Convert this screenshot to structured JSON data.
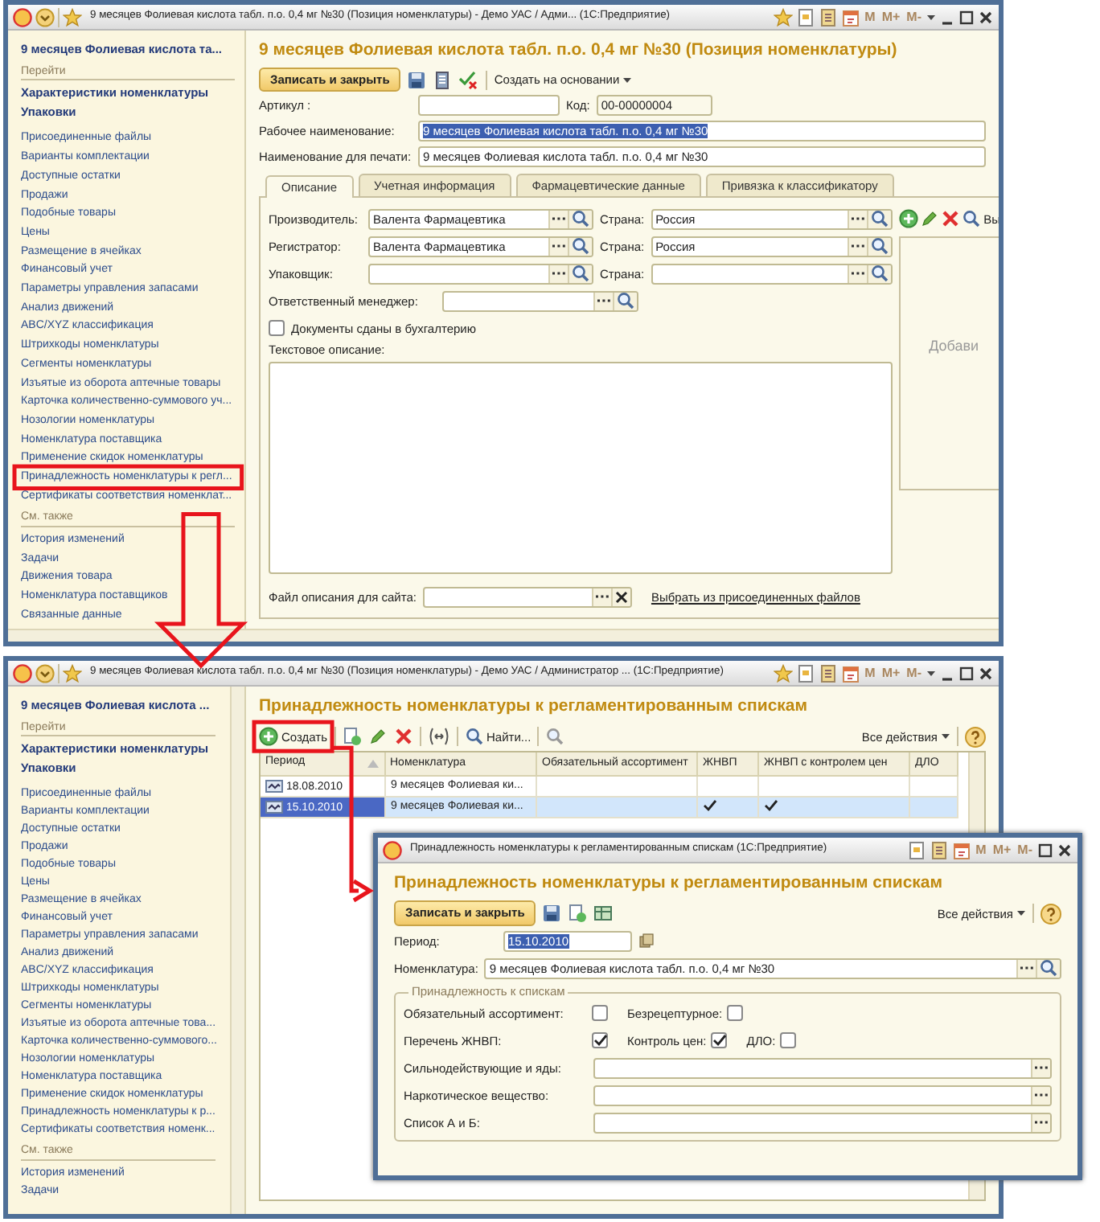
{
  "main_window": {
    "title": "9 месяцев Фолиевая кислота табл. п.о. 0,4 мг №30 (Позиция номенклатуры) - Демо УАС / Адми... (1С:Предприятие)",
    "memory_buttons": [
      "M",
      "M+",
      "M-"
    ],
    "sidebar": {
      "header": "9 месяцев Фолиевая кислота та...",
      "goto_label": "Перейти",
      "goto_items": [
        "Характеристики номенклатуры",
        "Упаковки"
      ],
      "items": [
        {
          "label": "Присоединенные файлы",
          "highlighted": false
        },
        {
          "label": "Варианты комплектации",
          "highlighted": false
        },
        {
          "label": "Доступные остатки",
          "highlighted": false
        },
        {
          "label": "Продажи",
          "highlighted": false
        },
        {
          "label": "Подобные товары",
          "highlighted": false
        },
        {
          "label": "Цены",
          "highlighted": false
        },
        {
          "label": "Размещение в ячейках",
          "highlighted": false
        },
        {
          "label": "Финансовый учет",
          "highlighted": false
        },
        {
          "label": "Параметры управления запасами",
          "highlighted": false
        },
        {
          "label": "Анализ движений",
          "highlighted": false
        },
        {
          "label": "ABC/XYZ классификация",
          "highlighted": false
        },
        {
          "label": "Штрихкоды номенклатуры",
          "highlighted": false
        },
        {
          "label": "Сегменты номенклатуры",
          "highlighted": false
        },
        {
          "label": "Изъятые из оборота аптечные товары",
          "highlighted": false
        },
        {
          "label": "Карточка количественно-суммового уч...",
          "highlighted": false
        },
        {
          "label": "Нозологии номенклатуры",
          "highlighted": false
        },
        {
          "label": "Номенклатура поставщика",
          "highlighted": false
        },
        {
          "label": "Применение скидок номенклатуры",
          "highlighted": false
        },
        {
          "label": "Принадлежность номенклатуры к регл...",
          "highlighted": true
        },
        {
          "label": "Сертификаты соответствия номенклат...",
          "highlighted": false
        }
      ],
      "see_also_label": "См. также",
      "see_also_items": [
        "История изменений",
        "Задачи",
        "Движения товара",
        "Номенклатура поставщиков",
        "Связанные данные"
      ]
    },
    "form": {
      "heading": "9 месяцев Фолиевая кислота табл. п.о. 0,4 мг №30 (Позиция номенклатуры)",
      "save_button": "Записать и закрыть",
      "create_based": "Создать на основании",
      "article_label": "Артикул :",
      "code_label": "Код:",
      "code_value": "00-00000004",
      "working_name": {
        "label": "Рабочее наименование:",
        "value": "9 месяцев Фолиевая кислота табл. п.о. 0,4 мг №30",
        "text_selected": true
      },
      "print_name": {
        "label": "Наименование для печати:",
        "value": "9 месяцев Фолиевая кислота табл. п.о. 0,4 мг №30",
        "text_selected": false
      },
      "tabs": [
        {
          "label": "Описание",
          "selected": true
        },
        {
          "label": "Учетная информация",
          "selected": false
        },
        {
          "label": "Фармацевтические данные",
          "selected": false
        },
        {
          "label": "Привязка к классификатору",
          "selected": false
        }
      ],
      "parties": [
        {
          "label": "Производитель:",
          "value": "Валента Фармацевтика",
          "country_label": "Страна:",
          "country": "Россия"
        },
        {
          "label": "Регистратор:",
          "value": "Валента Фармацевтика",
          "country_label": "Страна:",
          "country": "Россия"
        },
        {
          "label": "Упаковщик:",
          "country_label": "Страна:"
        }
      ],
      "manager_label": "Ответственный менеджер:",
      "docs_checkbox": {
        "label": "Документы сданы в бухгалтерию",
        "checked": false
      },
      "description_label": "Текстовое описание:",
      "file_label": "Файл описания для сайта:",
      "file_link": "Выбрать из присоединенных файлов",
      "side_panel": {
        "toolbar_text": "Вы",
        "placeholder": "Добави"
      }
    }
  },
  "list_window": {
    "title": "9 месяцев Фолиевая кислота табл. п.о. 0,4 мг №30 (Позиция номенклатуры) - Демо УАС / Администратор ... (1С:Предприятие)",
    "memory_buttons": [
      "M",
      "M+",
      "M-"
    ],
    "sidebar": {
      "header": "9 месяцев Фолиевая кислота ...",
      "goto_label": "Перейти",
      "goto_items": [
        "Характеристики номенклатуры",
        "Упаковки"
      ],
      "items": [
        {
          "label": "Присоединенные файлы",
          "highlighted": false
        },
        {
          "label": "Варианты комплектации",
          "highlighted": false
        },
        {
          "label": "Доступные остатки",
          "highlighted": false
        },
        {
          "label": "Продажи",
          "highlighted": false
        },
        {
          "label": "Подобные товары",
          "highlighted": false
        },
        {
          "label": "Цены",
          "highlighted": false
        },
        {
          "label": "Размещение в ячейках",
          "highlighted": false
        },
        {
          "label": "Финансовый учет",
          "highlighted": false
        },
        {
          "label": "Параметры управления запасами",
          "highlighted": false
        },
        {
          "label": "Анализ движений",
          "highlighted": false
        },
        {
          "label": "ABC/XYZ классификация",
          "highlighted": false
        },
        {
          "label": "Штрихкоды номенклатуры",
          "highlighted": false
        },
        {
          "label": "Сегменты номенклатуры",
          "highlighted": false
        },
        {
          "label": "Изъятые из оборота аптечные това...",
          "highlighted": false
        },
        {
          "label": "Карточка количественно-суммового...",
          "highlighted": false
        },
        {
          "label": "Нозологии номенклатуры",
          "highlighted": false
        },
        {
          "label": "Номенклатура поставщика",
          "highlighted": false
        },
        {
          "label": "Применение скидок номенклатуры",
          "highlighted": false
        },
        {
          "label": "Принадлежность номенклатуры к р...",
          "highlighted": false
        },
        {
          "label": "Сертификаты соответствия номенк...",
          "highlighted": false
        }
      ],
      "see_also_label": "См. также",
      "see_also_items": [
        "История изменений",
        "Задачи"
      ]
    },
    "heading": "Принадлежность номенклатуры к регламентированным спискам",
    "create_button": {
      "label": "Создать",
      "highlighted": true
    },
    "find_button": "Найти...",
    "all_actions": "Все действия",
    "columns": [
      "Период",
      "Номенклатура",
      "Обязательный ассортимент",
      "ЖНВП",
      "ЖНВП с контролем цен",
      "ДЛО"
    ],
    "rows": [
      {
        "period": "18.08.2010",
        "item": "9 месяцев Фолиевая ки...",
        "mandatory": false,
        "essential": false,
        "price_control": false,
        "dlo": false,
        "selected": false
      },
      {
        "period": "15.10.2010",
        "item": "9 месяцев Фолиевая ки...",
        "mandatory": false,
        "essential": true,
        "price_control": true,
        "dlo": false,
        "selected": true
      }
    ]
  },
  "dialog": {
    "title": "Принадлежность номенклатуры к регламентированным спискам  (1С:Предприятие)",
    "memory_buttons": [
      "M",
      "M+",
      "M-"
    ],
    "heading": "Принадлежность номенклатуры к регламентированным спискам",
    "save_button": "Записать и закрыть",
    "all_actions": "Все действия",
    "period": {
      "label": "Период:",
      "value": "15.10.2010",
      "text_selected": true
    },
    "item": {
      "label": "Номенклатура:",
      "value": "9 месяцев Фолиевая кислота табл. п.о. 0,4 мг №30"
    },
    "group_title": "Принадлежность к спискам",
    "checkbox_rows": [
      {
        "items": [
          {
            "label": "Обязательный ассортимент:",
            "checked": false
          },
          {
            "label": "Безрецептурное:",
            "checked": false
          }
        ]
      },
      {
        "items": [
          {
            "label": "Перечень ЖНВП:",
            "checked": true
          },
          {
            "label": "Контроль цен:",
            "checked": true
          },
          {
            "label": "ДЛО:",
            "checked": false
          }
        ]
      }
    ],
    "text_fields": [
      "Сильнодействующие и яды:",
      "Наркотическое вещество:",
      "Список А и Б:"
    ]
  }
}
